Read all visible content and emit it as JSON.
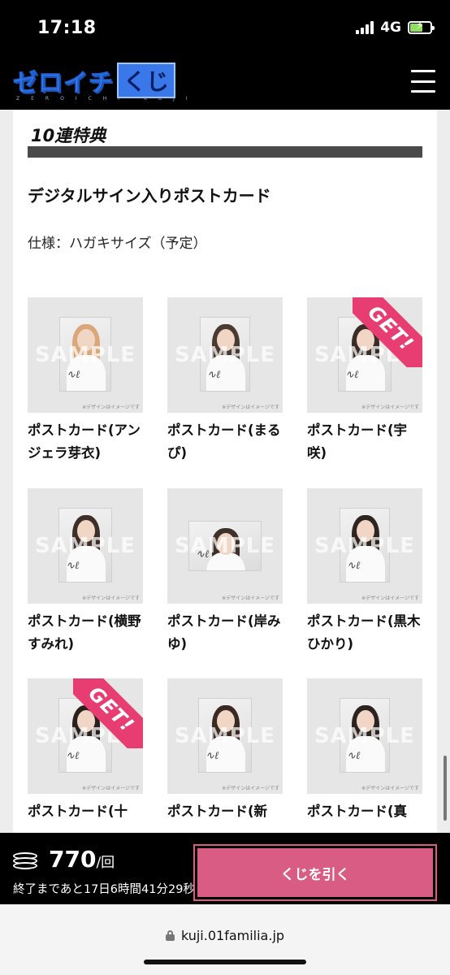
{
  "status_bar": {
    "time": "17:18",
    "network": "4G"
  },
  "header": {
    "logo_text": "ゼロイチ",
    "logo_box_text": "くじ",
    "logo_sub": "ZEROICHI KUJI",
    "menu_icon": "hamburger-menu-icon"
  },
  "content": {
    "bonus_title": "10連特典",
    "item_title": "デジタルサイン入りポストカード",
    "item_spec": "仕様：ハガキサイズ（予定）",
    "sample_watermark": "SAMPLE",
    "disclaimer": "※デザインはイメージです",
    "get_label": "GET!",
    "cards": [
      {
        "label": "ポストカード(アンジェラ芽衣)",
        "got": false,
        "hair": "#d9a77a"
      },
      {
        "label": "ポストカード(まるぴ)",
        "got": false,
        "hair": "#4a3a30"
      },
      {
        "label": "ポストカード(宇咲)",
        "got": true,
        "hair": "#3a2c26"
      },
      {
        "label": "ポストカード(横野すみれ)",
        "got": false,
        "hair": "#3d2e28"
      },
      {
        "label": "ポストカード(岸みゆ)",
        "got": false,
        "hair": "#40302a"
      },
      {
        "label": "ポストカード(黒木ひかり)",
        "got": false,
        "hair": "#2e2420"
      },
      {
        "label": "ポストカード(十",
        "got": true,
        "hair": "#2a201c"
      },
      {
        "label": "ポストカード(新",
        "got": false,
        "hair": "#3a2a22"
      },
      {
        "label": "ポストカード(真",
        "got": false,
        "hair": "#2c2320"
      }
    ]
  },
  "purchase": {
    "price": "770",
    "per": "/回",
    "countdown": "終了まであと17日6時間41分29秒",
    "draw_button": "くじを引く"
  },
  "browser": {
    "url": "kuji.01familia.jp"
  },
  "colors": {
    "accent_pink": "#d95c85",
    "get_pink": "#e83d72",
    "header_bg": "#000000"
  }
}
